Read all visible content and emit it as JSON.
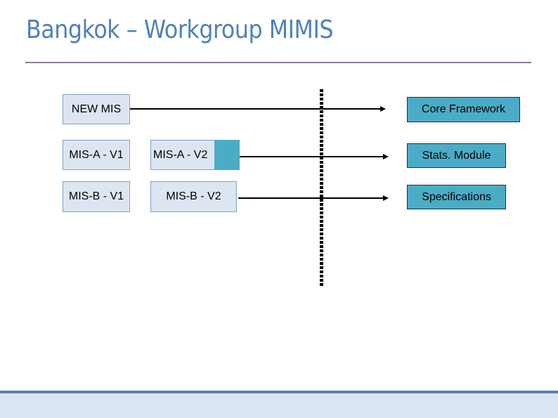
{
  "slide": {
    "title": "Bangkok – Workgroup MIMIS"
  },
  "diagram": {
    "sources": {
      "new_mis": "NEW MIS",
      "mis_a_v1": "MIS-A - V1",
      "mis_b_v1": "MIS-B - V1",
      "mis_a_v2": "MIS-A - V2",
      "mis_b_v2": "MIS-B - V2"
    },
    "targets": {
      "core_framework": "Core Framework",
      "stats_module": "Stats. Module",
      "specifications": "Specifications"
    }
  },
  "colors": {
    "title": "#4f81bd",
    "box_light": "#dce6f2",
    "box_target": "#4bacc6",
    "footer": "#dbe5f1",
    "footer_rule": "#5a7fb0"
  }
}
